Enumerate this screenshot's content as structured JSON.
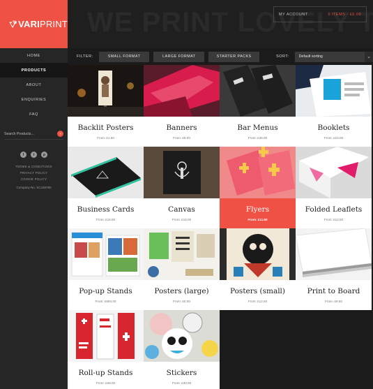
{
  "brand": {
    "logo_text_bold": "VARI",
    "logo_text": "PRINT",
    "accent": "#ef5144"
  },
  "header": {
    "hero_text": "WE PRINT LOVELY THINGS",
    "account_label": "MY ACCOUNT",
    "cart_label": "0 ITEMS - £0.00"
  },
  "nav": {
    "items": [
      {
        "label": "HOME"
      },
      {
        "label": "PRODUCTS"
      },
      {
        "label": "ABOUT"
      },
      {
        "label": "ENQUIRIES"
      },
      {
        "label": "FAQ"
      }
    ],
    "active_index": 1
  },
  "search": {
    "placeholder": "Search Products..."
  },
  "social": {
    "icons": [
      "facebook-icon",
      "twitter-icon",
      "pinterest-icon"
    ]
  },
  "footer": {
    "links": [
      "TERMS & CONDITIONS",
      "PRIVACY POLICY",
      "COOKIE POLICY"
    ],
    "company": "Company No. SC435780"
  },
  "filters": {
    "label": "FILTER:",
    "buttons": [
      "SMALL FORMAT",
      "LARGE FORMAT",
      "STARTER PACKS"
    ],
    "sort_label": "SORT:",
    "sort_value": "Default sorting"
  },
  "products": [
    {
      "title": "Backlit Posters",
      "price": "From: £1.50"
    },
    {
      "title": "Banners",
      "price": "From: £8.00"
    },
    {
      "title": "Bar Menus",
      "price": "From: £36.00"
    },
    {
      "title": "Booklets",
      "price": "From: £23.00"
    },
    {
      "title": "Business Cards",
      "price": "From: £15.50"
    },
    {
      "title": "Canvas",
      "price": "From: £16.00"
    },
    {
      "title": "Flyers",
      "price": "From: £11.50"
    },
    {
      "title": "Folded Leaflets",
      "price": "From: £12.50"
    },
    {
      "title": "Pop-up Stands",
      "price": "From: £594.00"
    },
    {
      "title": "Posters (large)",
      "price": "From: £5.00"
    },
    {
      "title": "Posters (small)",
      "price": "From: £12.50"
    },
    {
      "title": "Print to Board",
      "price": "From: £9.50"
    },
    {
      "title": "Roll-up Stands",
      "price": "From: £69.00"
    },
    {
      "title": "Stickers",
      "price": "From: £30.00"
    }
  ]
}
